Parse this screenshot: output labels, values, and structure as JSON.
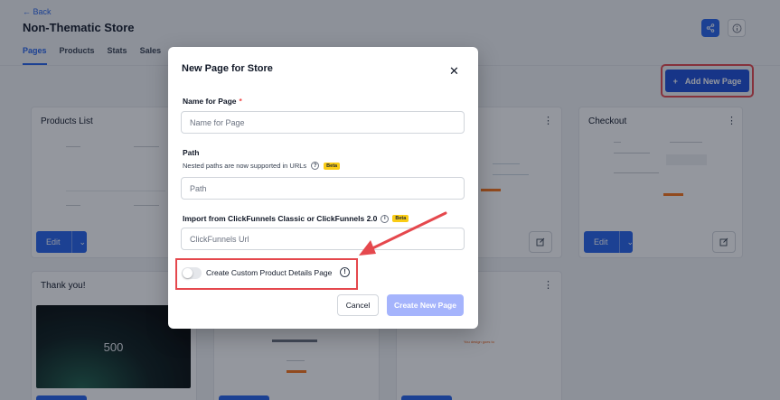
{
  "header": {
    "back_label": "← Back",
    "store_title": "Non-Thematic Store",
    "tabs": [
      "Pages",
      "Products",
      "Stats",
      "Sales"
    ],
    "active_tab": "Pages",
    "add_button_label": "Add New Page"
  },
  "cards": [
    {
      "title": "Products List",
      "edit_label": "Edit"
    },
    {
      "title": "Checkout",
      "edit_label": "Edit"
    },
    {
      "title": "Thank you!",
      "thumb_text": "500"
    },
    {
      "thumb_text": "You design goes to"
    }
  ],
  "modal": {
    "title": "New Page for Store",
    "name_label": "Name for Page",
    "name_required": "*",
    "name_placeholder": "Name for Page",
    "path_label": "Path",
    "path_hint": "Nested paths are now supported in URLs",
    "path_placeholder": "Path",
    "beta_badge": "Beta",
    "import_label": "Import from ClickFunnels Classic or ClickFunnels 2.0",
    "import_placeholder": "ClickFunnels Url",
    "toggle_label": "Create Custom Product Details Page",
    "toggle_on": false,
    "cancel_label": "Cancel",
    "create_label": "Create New Page"
  },
  "colors": {
    "primary": "#2563eb",
    "highlight": "#e5484d",
    "beta": "#facc15",
    "create_disabled": "#a5b4fc"
  },
  "icons": {
    "share": "share-icon",
    "info": "info-icon",
    "plus": "plus-icon",
    "close": "close-icon",
    "kebab": "kebab-menu-icon",
    "external": "external-link-icon",
    "chevron": "chevron-down-icon",
    "help": "question-icon"
  }
}
